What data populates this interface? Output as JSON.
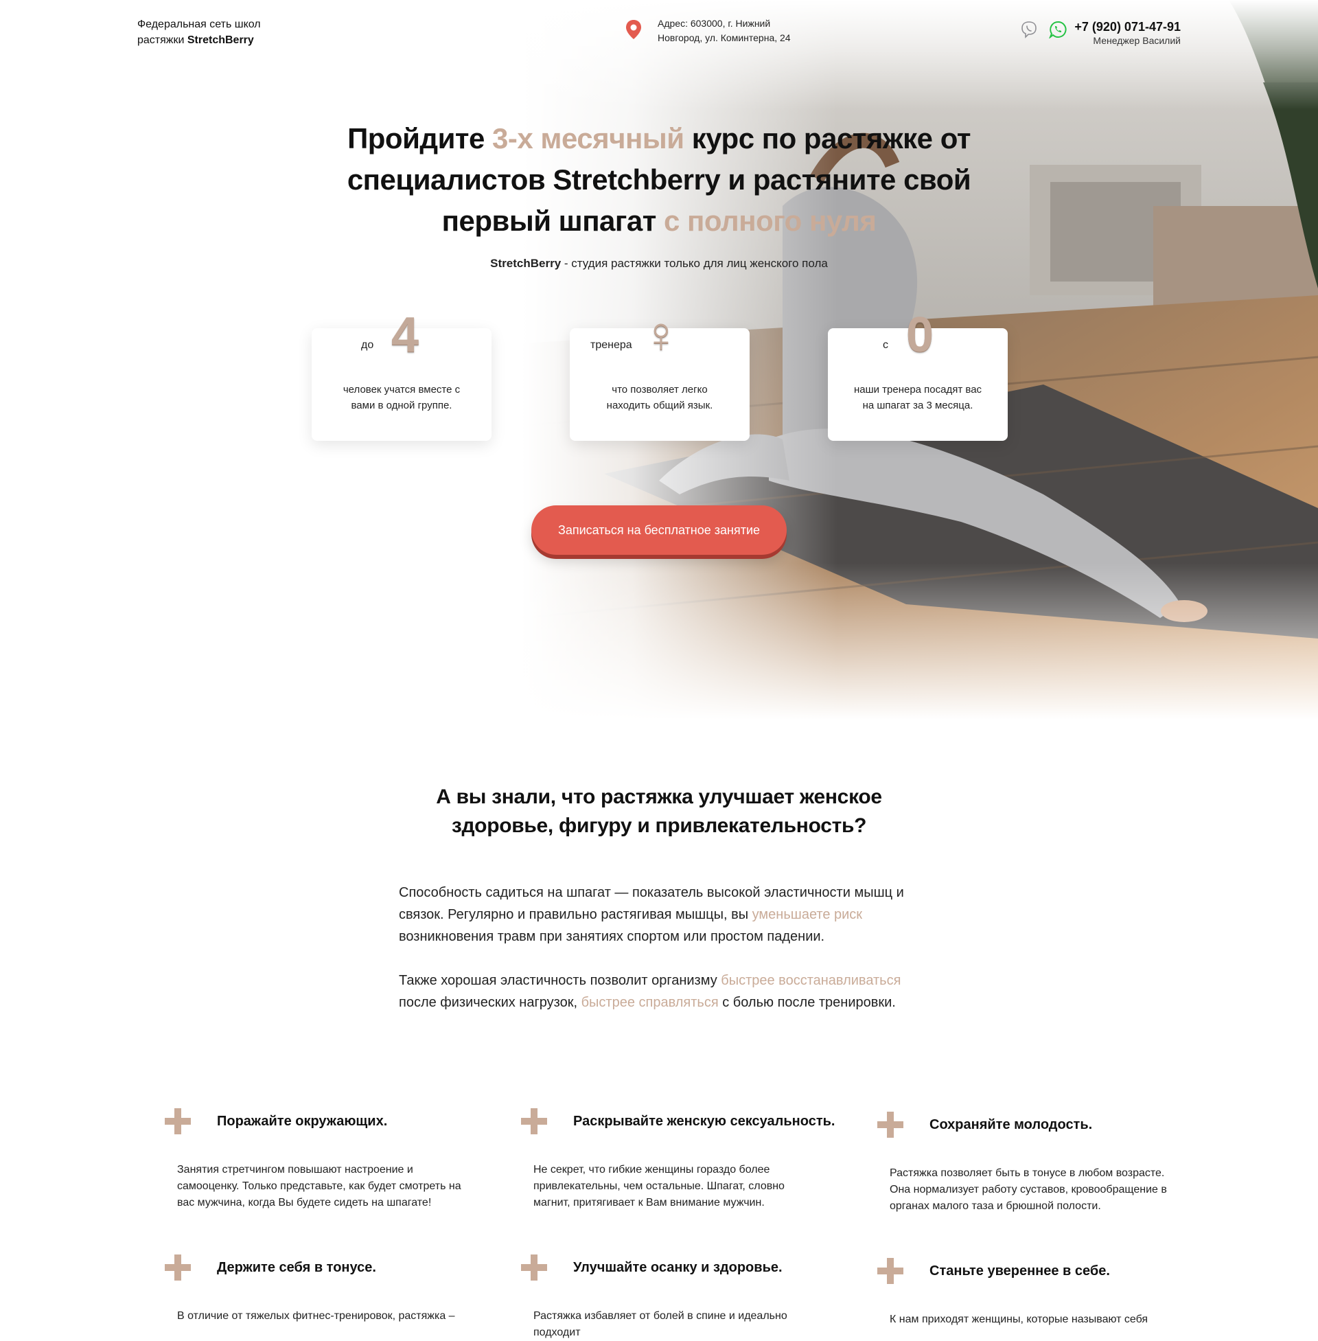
{
  "header": {
    "brand_line1": "Федеральная сеть школ",
    "brand_line2_prefix": "растяжки ",
    "brand_name": "StretchBerry",
    "address_line1": "Адрес: 603000, г. Нижний",
    "address_line2": "Новгород, ул. Коминтерна, 24",
    "phone": "+7 (920) 071-47-91",
    "manager": "Менеджер Василий",
    "messengers": [
      "viber-icon",
      "whatsapp-icon"
    ]
  },
  "hero": {
    "title_p1": "Пройдите ",
    "title_accent1": "3-х месячный",
    "title_p2": " курс по растяжке от специалистов  Stretchberry и растяните свой первый шпагат ",
    "title_accent2": "с полного нуля",
    "subtitle_brand": "StretchBerry",
    "subtitle_rest": " - студия растяжки только для лиц женского пола",
    "stats": [
      {
        "pre": "до",
        "big": "4",
        "desc": "человек учатся вместе с вами в одной группе."
      },
      {
        "pre": "тренера",
        "big": "♀",
        "desc": "что позволяет легко находить общий язык."
      },
      {
        "pre": "с",
        "big": "0",
        "desc": "наши тренера посадят вас на шпагат за 3 месяца."
      }
    ],
    "cta_label": "Записаться на бесплатное занятие"
  },
  "info": {
    "title": "А вы знали, что растяжка улучшает женское здоровье, фигуру и привлекательность?",
    "p1_a": "Способность садиться на шпагат — показатель высокой эластичности мышц и связок. Регулярно и правильно растягивая мышцы, вы ",
    "p1_accent": "уменьшаете риск",
    "p1_b": " возникновения травм при занятиях спортом или простом падении.",
    "p2_a": "Также хорошая эластичность позволит организму ",
    "p2_accent1": "быстрее восстанавливаться",
    "p2_b": " после физических нагрузок, ",
    "p2_accent2": "быстрее справляться",
    "p2_c": " с болью после тренировки."
  },
  "benefits": [
    {
      "title": "Поражайте окружающих.",
      "text": "Занятия стретчингом повышают настроение и самооценку. Только представьте, как будет смотреть на вас мужчина, когда Вы будете сидеть на шпагате!"
    },
    {
      "title": "Раскрывайте женскую сексуальность.",
      "text": "Не секрет, что гибкие женщины гораздо более привлекательны, чем остальные. Шпагат, словно магнит, притягивает к Вам внимание мужчин."
    },
    {
      "title": "Сохраняйте молодость.",
      "text": "Растяжка позволяет быть в тонусе в любом возрасте. Она нормализует работу суставов, кровообращение в органах малого таза и брюшной полости."
    },
    {
      "title": "Держите себя в тонусе.",
      "text": "В отличие от тяжелых фитнес-тренировок, растяжка –"
    },
    {
      "title": "Улучшайте осанку и здоровье.",
      "text": "Растяжка избавляет от болей в спине и идеально подходит"
    },
    {
      "title": "Станьте увереннее в себе.",
      "text": "К нам приходят женщины, которые называют себя"
    }
  ],
  "colors": {
    "accent": "#c9ab98",
    "cta": "#e35b4f"
  }
}
